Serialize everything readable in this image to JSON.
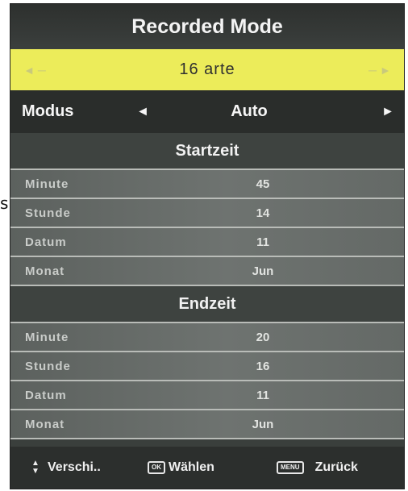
{
  "stray_char": "s",
  "title": "Recorded Mode",
  "channel": {
    "name": "16 arte",
    "left_icon": "arrow-left-icon",
    "right_icon": "arrow-right-icon"
  },
  "modus": {
    "label": "Modus",
    "value": "Auto",
    "left_arrow": "◄",
    "right_arrow": "►"
  },
  "start": {
    "heading": "Startzeit",
    "rows": [
      {
        "label": "Minute",
        "value": "45"
      },
      {
        "label": "Stunde",
        "value": "14"
      },
      {
        "label": "Datum",
        "value": "11"
      },
      {
        "label": "Monat",
        "value": "Jun"
      }
    ]
  },
  "end": {
    "heading": "Endzeit",
    "rows": [
      {
        "label": "Minute",
        "value": "20"
      },
      {
        "label": "Stunde",
        "value": "16"
      },
      {
        "label": "Datum",
        "value": "11"
      },
      {
        "label": "Monat",
        "value": "Jun"
      }
    ]
  },
  "footer": {
    "move_label": "Verschi..",
    "ok_key": "OK",
    "select_label": "Wählen",
    "menu_key": "MENU",
    "back_label": "Zurück"
  },
  "colors": {
    "highlight_bar": "#ecec5a",
    "panel_bg": "#3a3f3c",
    "row_bg": "#6e7370"
  }
}
